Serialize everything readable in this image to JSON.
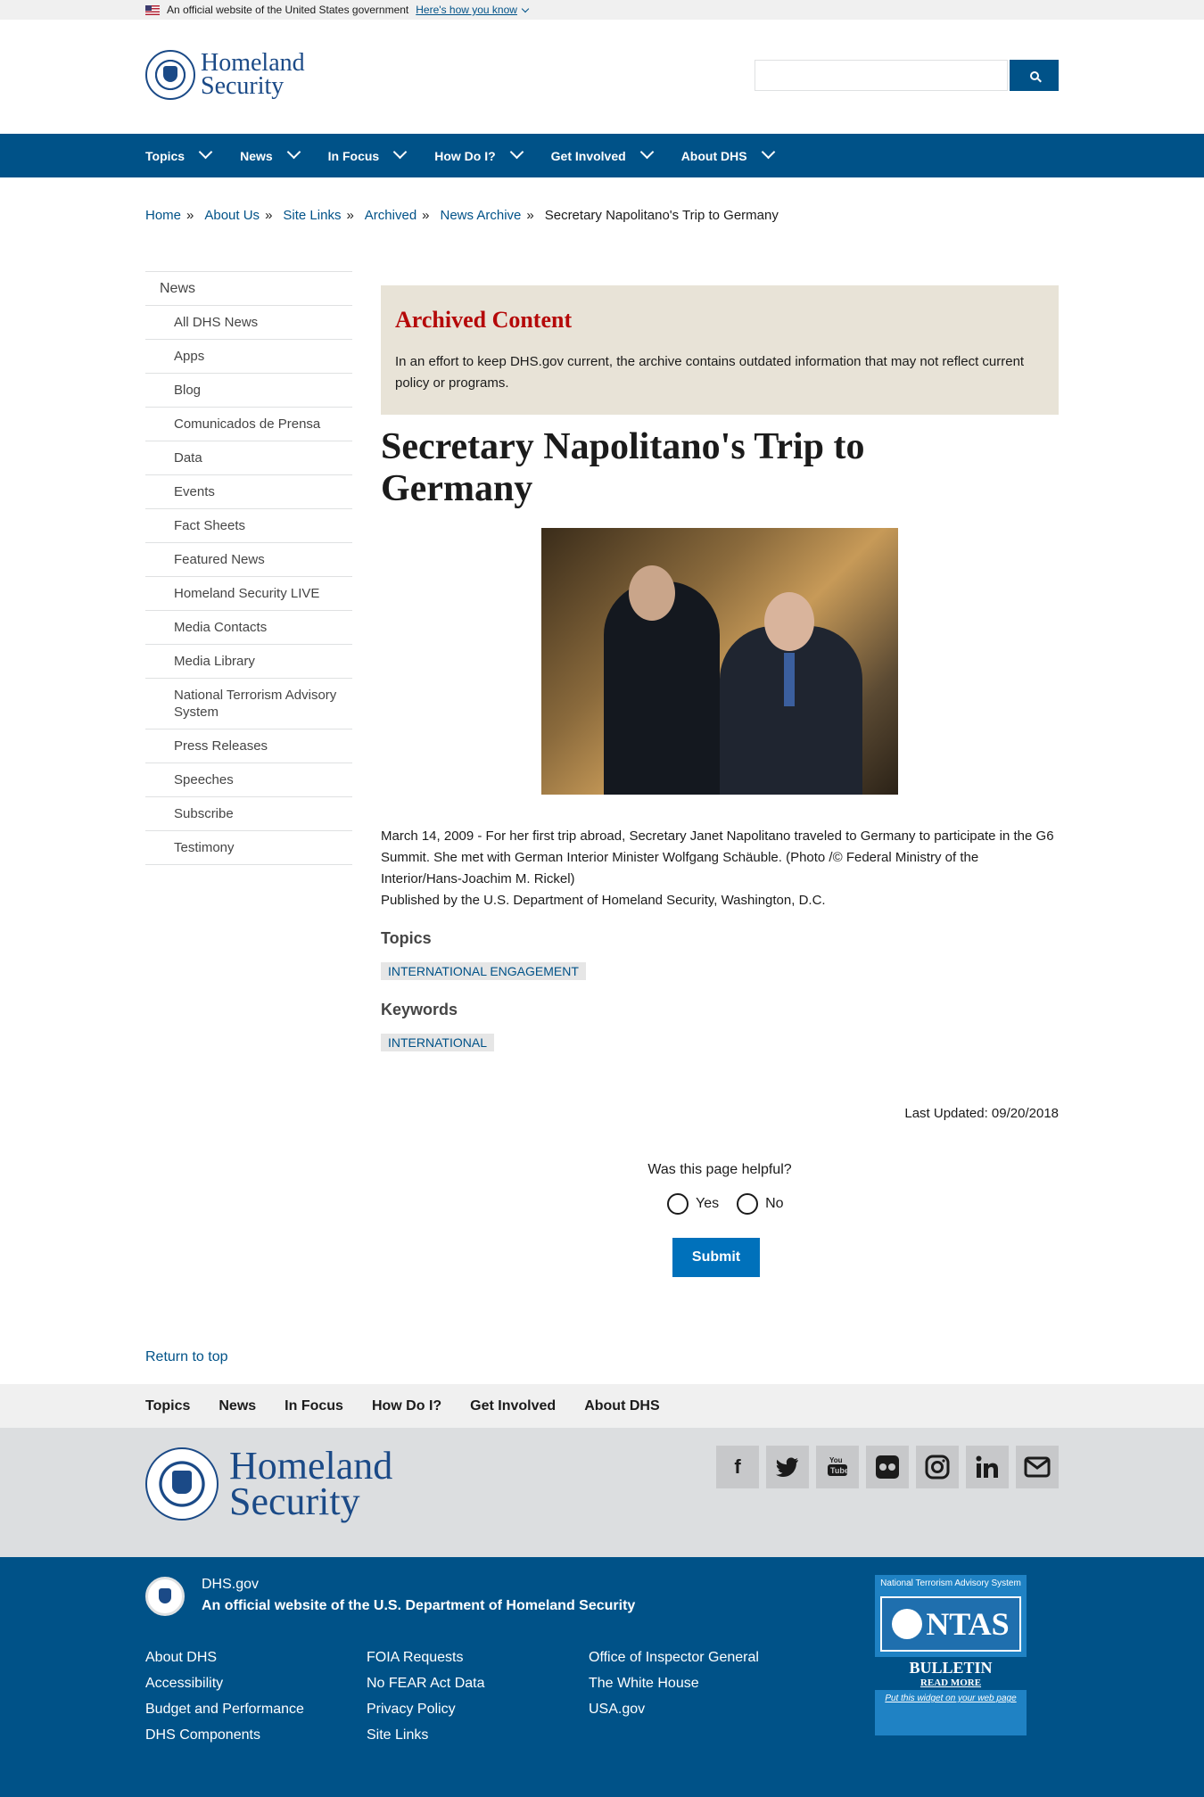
{
  "gov_banner": {
    "text": "An official website of the United States government",
    "link": "Here's how you know"
  },
  "header": {
    "logo_line1": "Homeland",
    "logo_line2": "Security",
    "search_placeholder": ""
  },
  "nav": [
    "Topics",
    "News",
    "In Focus",
    "How Do I?",
    "Get Involved",
    "About DHS"
  ],
  "breadcrumb": {
    "links": [
      "Home",
      "About Us",
      "Site Links",
      "Archived",
      "News Archive"
    ],
    "current": "Secretary Napolitano's Trip to Germany"
  },
  "sidebar": {
    "heading": "News",
    "items": [
      "All DHS News",
      "Apps",
      "Blog",
      "Comunicados de Prensa",
      "Data",
      "Events",
      "Fact Sheets",
      "Featured News",
      "Homeland Security LIVE",
      "Media Contacts",
      "Media Library",
      "National Terrorism Advisory System",
      "Press Releases",
      "Speeches",
      "Subscribe",
      "Testimony"
    ]
  },
  "archived": {
    "title": "Archived Content",
    "body": "In an effort to keep DHS.gov current, the archive contains outdated information that may not reflect current policy or programs."
  },
  "article": {
    "title": "Secretary Napolitano's Trip to Germany",
    "caption": "March 14, 2009 - For her first trip abroad, Secretary Janet Napolitano traveled to Germany to participate in the G6 Summit. She met with German Interior Minister Wolfgang Schäuble. (Photo /© Federal Ministry of the Interior/Hans-Joachim M. Rickel)",
    "published": "Published by the U.S. Department of Homeland Security, Washington, D.C.",
    "topics_heading": "Topics",
    "topic_tag": "INTERNATIONAL ENGAGEMENT",
    "keywords_heading": "Keywords",
    "keyword_tag": "INTERNATIONAL",
    "last_updated": "Last Updated: 09/20/2018"
  },
  "feedback": {
    "question": "Was this page helpful?",
    "yes": "Yes",
    "no": "No",
    "submit": "Submit"
  },
  "return_to_top": "Return to top",
  "footer": {
    "nav": [
      "Topics",
      "News",
      "In Focus",
      "How Do I?",
      "Get Involved",
      "About DHS"
    ],
    "logo_line1": "Homeland",
    "logo_line2": "Security",
    "socials": [
      "facebook-icon",
      "twitter-icon",
      "youtube-icon",
      "flickr-icon",
      "instagram-icon",
      "linkedin-icon",
      "email-icon"
    ],
    "site": "DHS.gov",
    "official_prefix": "An official website of the",
    "official_link": "U.S. Department of Homeland Security",
    "col1": [
      "About DHS",
      "Accessibility",
      "Budget and Performance",
      "DHS Components"
    ],
    "col2": [
      "FOIA Requests",
      "No FEAR Act Data",
      "Privacy Policy",
      "Site Links"
    ],
    "col3": [
      "Office of Inspector General",
      "The White House",
      "USA.gov"
    ],
    "ntas": {
      "title": "National Terrorism Advisory System",
      "logo": "NTAS",
      "bulletin": "BULLETIN",
      "read_more": "READ MORE",
      "put_widget": "Put this widget on your web page"
    }
  }
}
